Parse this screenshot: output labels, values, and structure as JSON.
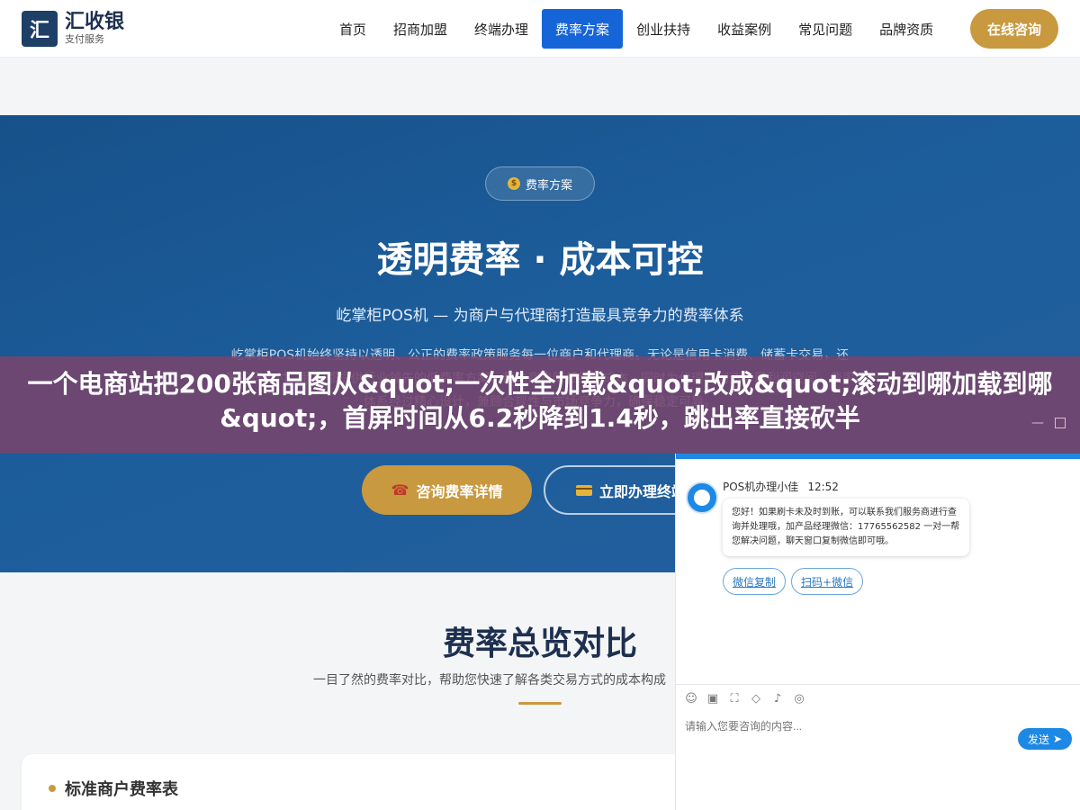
{
  "header": {
    "logo_mark": "汇",
    "logo_title": "汇收银",
    "logo_subtitle": "支付服务",
    "nav": [
      {
        "label": "首页"
      },
      {
        "label": "招商加盟"
      },
      {
        "label": "终端办理"
      },
      {
        "label": "费率方案",
        "active": true
      },
      {
        "label": "创业扶持"
      },
      {
        "label": "收益案例"
      },
      {
        "label": "常见问题"
      },
      {
        "label": "品牌资质"
      }
    ],
    "cta": "在线咨询",
    "accent_color": "#1565d8",
    "gold_color": "#c9993f"
  },
  "hero": {
    "badge": "费率方案",
    "title": "透明费率 · 成本可控",
    "subtitle": "屹掌柜POS机 — 为商户与代理商打造最具竞争力的费率体系",
    "description": "屹掌柜POS机始终坚持以透明、公正的费率政策服务每一位商户和代理商。无论是信用卡消费、储蓄卡交易，还是扫码支付，我们都提供行业领先的低费率方案，帮助商户降低经营成本，同时为代理商创造丰厚利润空间。费率体系经过精心设计，兼顾合规性与市场竞争力，确保稳定可靠。",
    "button_primary": "咨询费率详情",
    "button_secondary": "立即办理终端"
  },
  "overview": {
    "title": "费率总览对比",
    "subtitle": "一目了然的费率对比，帮助您快速了解各类交易方式的成本构成",
    "table_title": "标准商户费率表"
  },
  "overlay": {
    "text": "一个电商站把200张商品图从&quot;一次性全加载&quot;改成&quot;滚动到哪加载到哪&quot;，首屏时间从6.2秒降到1.4秒，跳出率直接砍半"
  },
  "chat": {
    "agent_name": "POS机办理小佳",
    "time": "12:52",
    "message": "您好！如果刷卡未及时到账，可以联系我们服务商进行查询并处理哦，加产品经理微信：17765562582 一对一帮您解决问题，聊天窗口复制微信即可哦。",
    "actions": [
      "微信复制",
      "扫码+微信"
    ],
    "input_placeholder": "请输入您要咨询的内容...",
    "send_label": "发送"
  }
}
